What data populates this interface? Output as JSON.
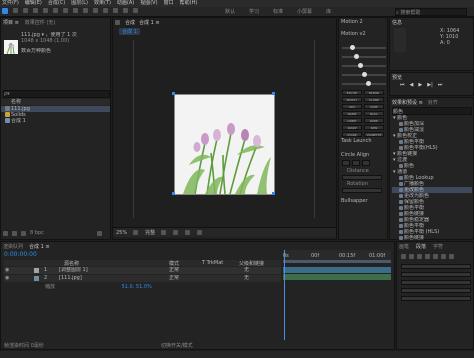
{
  "menu": [
    "文件(F)",
    "编辑(E)",
    "合成(C)",
    "图层(L)",
    "效果(T)",
    "动画(A)",
    "视图(V)",
    "窗口",
    "帮助(H)"
  ],
  "workspace_tabs": [
    "默认",
    "学习",
    "标准",
    "小屏幕",
    "库"
  ],
  "search_help": "搜索帮助",
  "project": {
    "tabs": [
      "项目 ≡",
      "效果控件 (无)"
    ],
    "preview_name": "111.jpg ▾ ，使用了 1 次",
    "preview_meta": "1048 x 1048 (1.00)",
    "preview_caption": "数百万种颜色",
    "search_placeholder": "ρ▾",
    "col_name": "名称",
    "items": [
      {
        "name": "111.jpg",
        "selected": true
      },
      {
        "name": "Solids",
        "selected": false
      },
      {
        "name": "合成 1",
        "selected": false
      }
    ],
    "footer": "8 bpc"
  },
  "composition": {
    "tabs": [
      "合成",
      "合成 1 ≡"
    ],
    "flow_tab": "合成 1",
    "zoom": "25%",
    "quality": "完整",
    "timecode_footer": "0:00:00:00"
  },
  "right": {
    "info_tab": "信息",
    "info_lines": [
      "X: 1064",
      "Y: 1010",
      "A: 0"
    ],
    "motion_title": "Motion 2",
    "motion_version": "Motion v2",
    "motion_buttons": [
      "EXCITE",
      "BLEND",
      "BURST",
      "CLONE",
      "DIM",
      "JUMP",
      "NAME",
      "NULL",
      "ORBIT",
      "ROPE",
      "WARP",
      "SPIN",
      "STARE",
      "VIGNETTE"
    ],
    "preview_tab": "预览",
    "effects_tab": "效果和预设 ≡",
    "effects_tab2": "对齐",
    "task_launch": "Task Launch",
    "circle_align": "Circle Align",
    "distance_label": "Distance",
    "rotation_label": "Rotation",
    "bullseye": "Bullsapper",
    "effects_search": "颜色",
    "effects_items": [
      {
        "name": "▾ 颜色",
        "indent": 0,
        "selected": false
      },
      {
        "name": "颜色加深",
        "indent": 1,
        "selected": false
      },
      {
        "name": "颜色减淡",
        "indent": 1,
        "selected": false
      },
      {
        "name": "▾ 颜色校正",
        "indent": 0,
        "selected": false
      },
      {
        "name": "颜色平衡",
        "indent": 1,
        "selected": false
      },
      {
        "name": "颜色平衡(HLS)",
        "indent": 1,
        "selected": false
      },
      {
        "name": "▾ 颜色链接",
        "indent": 0,
        "selected": false
      },
      {
        "name": "▾ 过渡",
        "indent": 0,
        "selected": false
      },
      {
        "name": "颜色",
        "indent": 1,
        "selected": false
      },
      {
        "name": "▾ 通道",
        "indent": 0,
        "selected": false
      },
      {
        "name": "颜色 Lookup",
        "indent": 1,
        "selected": false
      },
      {
        "name": "广播颜色",
        "indent": 1,
        "selected": false
      },
      {
        "name": "更改颜色",
        "indent": 1,
        "selected": true
      },
      {
        "name": "更改为颜色",
        "indent": 1,
        "selected": false
      },
      {
        "name": "保留颜色",
        "indent": 1,
        "selected": false
      },
      {
        "name": "颜色平衡",
        "indent": 1,
        "selected": false
      },
      {
        "name": "颜色链接",
        "indent": 1,
        "selected": false
      },
      {
        "name": "颜色稳定器",
        "indent": 1,
        "selected": false
      },
      {
        "name": "颜色平衡",
        "indent": 1,
        "selected": false
      },
      {
        "name": "颜色平衡 (HLS)",
        "indent": 1,
        "selected": false
      },
      {
        "name": "颜色链接",
        "indent": 1,
        "selected": false
      }
    ]
  },
  "timeline": {
    "tabs": [
      "渲染队列",
      "合成 1 ≡"
    ],
    "timecode": "0:00:00:00",
    "columns": [
      "源名称",
      "模式",
      "T TrkMat",
      "父级和链接"
    ],
    "layers": [
      {
        "num": "1",
        "name": "[调整图层 1]",
        "mode": "正常",
        "parent": "无"
      },
      {
        "num": "2",
        "name": "[111.jpg]",
        "mode": "正常",
        "parent": "无"
      }
    ],
    "transform_label": "缩放",
    "transform_value": "51.0, 51.0%",
    "ruler": [
      "0s",
      "00f",
      "00:15f",
      "01:00f"
    ],
    "footer_left": "帧渲染时间 0毫秒",
    "footer_mid": "切换开关/模式"
  },
  "bottom_right": {
    "tabs": [
      "画笔",
      "段落",
      "字符"
    ]
  },
  "colors": {
    "accent": "#2d8ceb",
    "playhead": "#4a90e2",
    "track": "#3a6b8c"
  }
}
